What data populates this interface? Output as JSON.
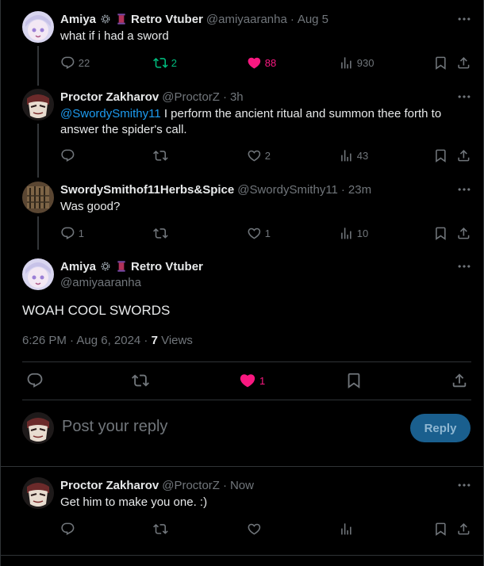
{
  "tweets": [
    {
      "name": "Amiya",
      "name_suffix": "Retro Vtuber",
      "handle": "@amiyaaranha",
      "sep": "·",
      "time": "Aug 5",
      "text": "what if i had a sword",
      "replies": "22",
      "retweets": "2",
      "likes": "88",
      "views": "930"
    },
    {
      "name": "Proctor Zakharov",
      "handle": "@ProctorZ",
      "sep": "·",
      "time": "3h",
      "mention": "@SwordySmithy11",
      "text": " I perform the ancient ritual and summon thee forth to answer the spider's call.",
      "replies": "",
      "retweets": "",
      "likes": "2",
      "views": "43"
    },
    {
      "name": "SwordySmithof11Herbs&Spice",
      "handle": "@SwordySmithy11",
      "sep": "·",
      "time": "23m",
      "text": "Was good?",
      "replies": "1",
      "retweets": "",
      "likes": "1",
      "views": "10"
    }
  ],
  "main_tweet": {
    "name": "Amiya",
    "name_suffix": "Retro Vtuber",
    "handle": "@amiyaaranha",
    "text": "WOAH COOL SWORDS",
    "timestamp": "6:26 PM · Aug 6, 2024 · ",
    "views_count": "7",
    "views_label": " Views",
    "likes": "1"
  },
  "composer": {
    "placeholder": "Post your reply",
    "button": "Reply"
  },
  "reply_tweet": {
    "name": "Proctor Zakharov",
    "handle": "@ProctorZ",
    "sep": "·",
    "time": "Now",
    "text": "Get him to make you one. :)"
  },
  "colors": {
    "like_active": "#f91880",
    "retweet_active": "#00ba7c",
    "mention": "#1d9bf0",
    "reply_button": "#1a5f8e"
  }
}
